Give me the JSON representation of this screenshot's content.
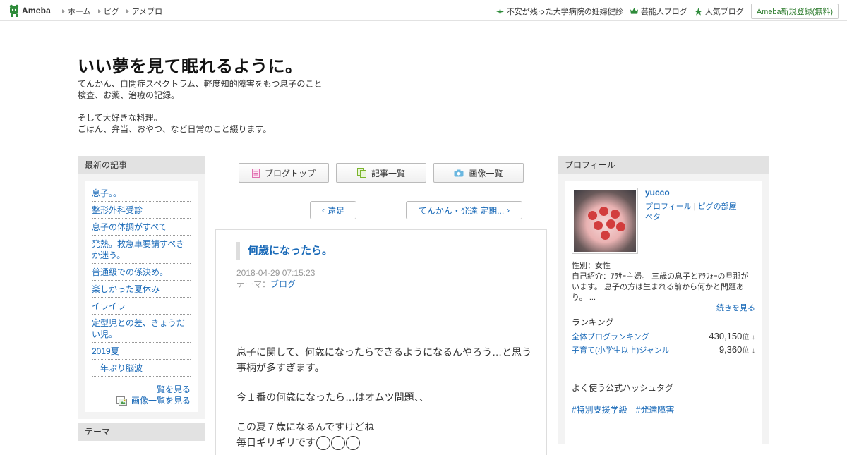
{
  "topbar": {
    "logo_text": "Ameba",
    "nav": [
      "ホーム",
      "ピグ",
      "アメブロ"
    ],
    "right_links": [
      {
        "label": "不安が残った大学病院の妊婦健診",
        "icon": "sparkle-icon"
      },
      {
        "label": "芸能人ブログ",
        "icon": "crown-icon"
      },
      {
        "label": "人気ブログ",
        "icon": "star-icon"
      }
    ],
    "register_label": "Ameba新規登録(無料)"
  },
  "header": {
    "title": "いい夢を見て眠れるように。",
    "description": "てんかん、自閉症スペクトラム、軽度知的障害をもつ息子のこと\n検査、お薬、治療の記録。\n\nそして大好きな料理。\nごはん、弁当、おやつ、など日常のこと綴ります。"
  },
  "left": {
    "recent_heading": "最新の記事",
    "recent_articles": [
      "息子。。",
      "整形外科受診",
      "息子の体調がすべて",
      "発熱。救急車要請すべきか迷う。",
      "普通級での係決め。",
      "楽しかった夏休み",
      "イライラ",
      "定型児との差、きょうだい児。",
      "2019夏",
      "一年ぶり脳波"
    ],
    "list_more": "一覧を見る",
    "image_list_more": "画像一覧を見る",
    "theme_heading": "テーマ"
  },
  "center": {
    "buttons": [
      {
        "label": "ブログトップ",
        "icon": "document-icon"
      },
      {
        "label": "記事一覧",
        "icon": "copy-icon"
      },
      {
        "label": "画像一覧",
        "icon": "camera-icon"
      }
    ],
    "prev_label": "遠足",
    "next_label": "てんかん・発達 定期...",
    "entry": {
      "title": "何歳になったら。",
      "date": "2018-04-29 07:15:23",
      "theme_prefix": "テーマ：",
      "theme": "ブログ",
      "paragraphs": [
        "息子に関して、何歳になったらできるようになるんやろう…と思う事柄が多すぎます。",
        "今１番の何歳になったら…はオムツ問題、、",
        "この夏７歳になるんですけどね"
      ],
      "last_line": "毎日ギリギリです"
    }
  },
  "right": {
    "heading": "プロフィール",
    "name": "yucco",
    "links": [
      "プロフィール",
      "ピグの部屋",
      "ペタ"
    ],
    "gender": "性別：女性",
    "intro": "自己紹介：ｱﾗｻｰ主婦。 三歳の息子とｱﾗﾌｫｰの旦那がいます。 息子の方は生まれる前から何かと問題あり。 ...",
    "more": "続きを見る",
    "ranking_heading": "ランキング",
    "rankings": [
      {
        "label": "全体ブログランキング",
        "value": "430,150",
        "unit": "位",
        "arrow": "↓"
      },
      {
        "label": "子育て(小学生以上)ジャンル",
        "value": "9,360",
        "unit": "位",
        "arrow": "↓"
      }
    ],
    "hashtag_heading": "よく使う公式ハッシュタグ",
    "hashtags": [
      "#特別支援学級",
      "#発達障害"
    ]
  },
  "colors": {
    "link": "#1a6ab8",
    "panel_head": "#e2e2e2",
    "panel_bg": "#f3f3f3",
    "ameba_green": "#2e8b3a"
  }
}
